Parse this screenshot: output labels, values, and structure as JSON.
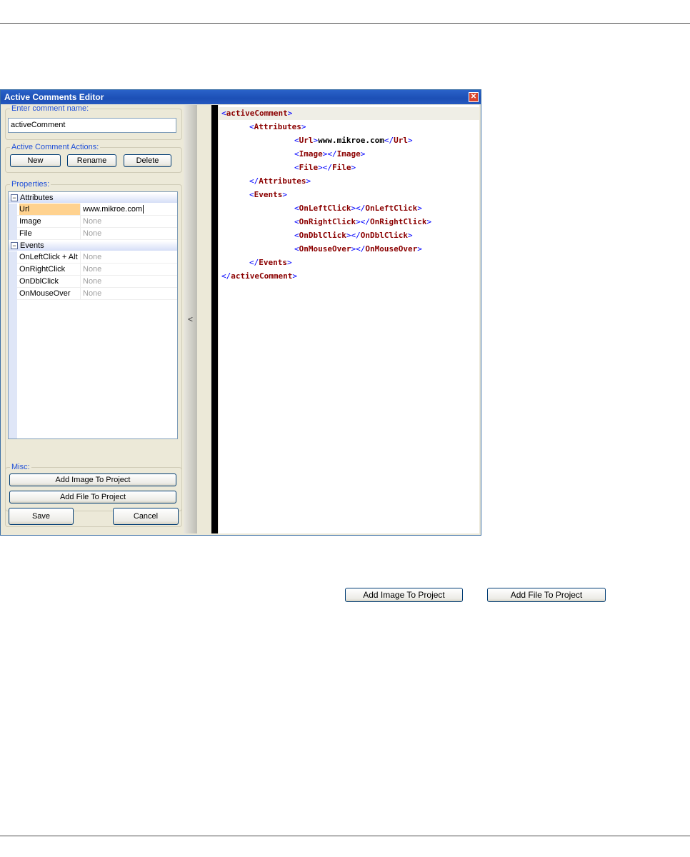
{
  "window": {
    "title": "Active Comments Editor"
  },
  "name_group": {
    "legend": "Enter comment name:",
    "value": "activeComment"
  },
  "actions_group": {
    "legend": "Active Comment Actions:",
    "new": "New",
    "rename": "Rename",
    "delete": "Delete"
  },
  "properties": {
    "legend": "Properties:",
    "categories": [
      "Attributes",
      "Events"
    ],
    "attributes": [
      {
        "name": "Url",
        "value": "www.mikroe.com"
      },
      {
        "name": "Image",
        "value": "None"
      },
      {
        "name": "File",
        "value": "None"
      }
    ],
    "events": [
      {
        "name": "OnLeftClick + Alt",
        "value": "None"
      },
      {
        "name": "OnRightClick",
        "value": "None"
      },
      {
        "name": "OnDblClick",
        "value": "None"
      },
      {
        "name": "OnMouseOver",
        "value": "None"
      }
    ]
  },
  "misc": {
    "legend": "Misc:",
    "add_image": "Add Image To Project",
    "add_file": "Add File  To Project"
  },
  "footer": {
    "save": "Save",
    "cancel": "Cancel"
  },
  "splitter_glyph": "<",
  "code_lines": [
    {
      "indent": 0,
      "open": "activeComment",
      "text": "",
      "close": ""
    },
    {
      "indent": 1,
      "open": "Attributes",
      "text": "",
      "close": ""
    },
    {
      "indent": 2,
      "open": "Url",
      "text": "www.mikroe.com",
      "close": "Url"
    },
    {
      "indent": 2,
      "open": "Image",
      "text": "",
      "close": "Image"
    },
    {
      "indent": 2,
      "open": "File",
      "text": "",
      "close": "File"
    },
    {
      "indent": 1,
      "open": "",
      "text": "",
      "close": "Attributes"
    },
    {
      "indent": 1,
      "open": "Events",
      "text": "",
      "close": ""
    },
    {
      "indent": 2,
      "open": "OnLeftClick",
      "text": "",
      "close": "OnLeftClick"
    },
    {
      "indent": 2,
      "open": "OnRightClick",
      "text": "",
      "close": "OnRightClick"
    },
    {
      "indent": 2,
      "open": "OnDblClick",
      "text": "",
      "close": "OnDblClick"
    },
    {
      "indent": 2,
      "open": "OnMouseOver",
      "text": "",
      "close": "OnMouseOver"
    },
    {
      "indent": 1,
      "open": "",
      "text": "",
      "close": "Events"
    },
    {
      "indent": 0,
      "open": "",
      "text": "",
      "close": "activeComment"
    }
  ],
  "standalone_buttons": {
    "add_image": "Add Image To Project",
    "add_file": "Add File  To Project"
  }
}
